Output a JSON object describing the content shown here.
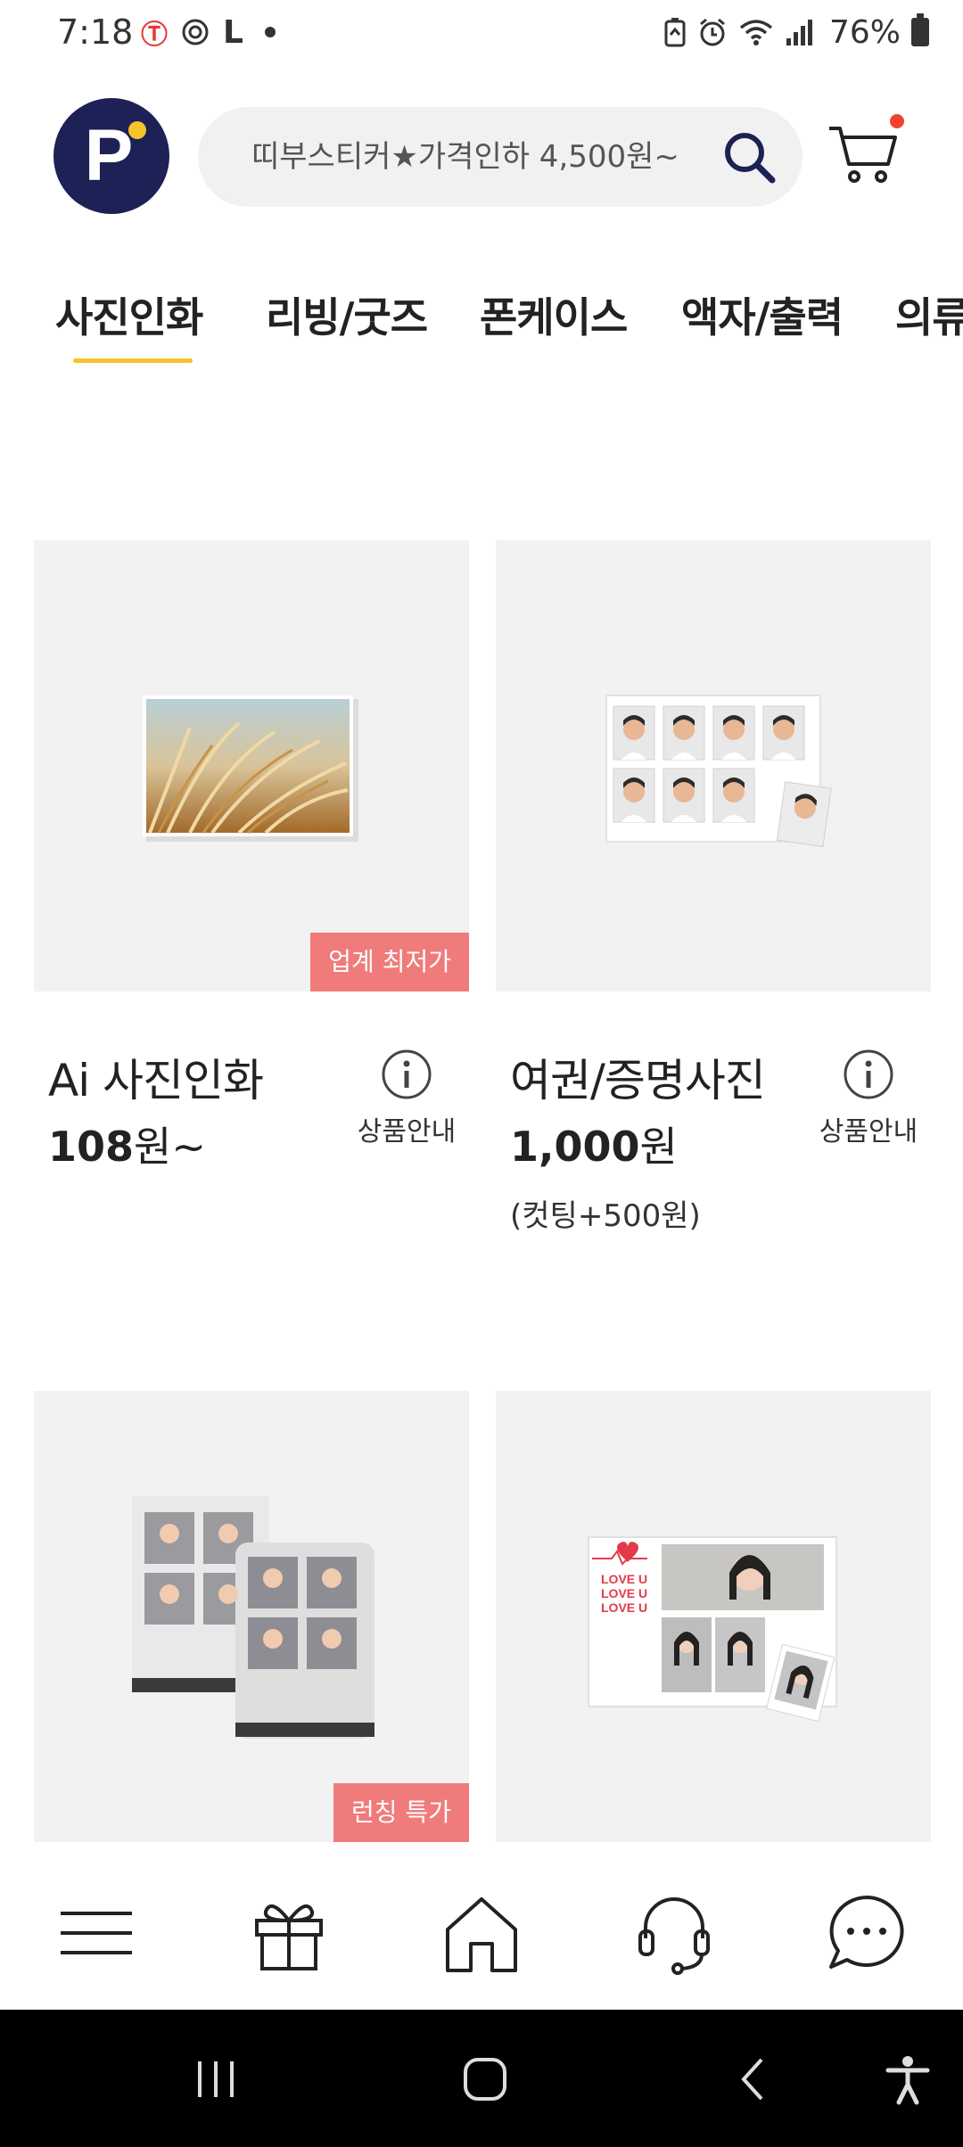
{
  "status_bar": {
    "time": "7:18",
    "left_icons": [
      "t-icon",
      "target-icon",
      "l-icon",
      "dot-icon"
    ],
    "right_icons": [
      "battery-saver-icon",
      "alarm-icon",
      "wifi-icon",
      "signal-icon"
    ],
    "battery_text": "76%"
  },
  "header": {
    "logo_letter": "P",
    "search_text": "띠부스티커★가격인하 4,500원~",
    "colors": {
      "logo_bg": "#1d2155",
      "logo_dot": "#f6c32b",
      "cart_dot": "#f0432e"
    }
  },
  "tabs": [
    {
      "label": "사진인화",
      "active": true
    },
    {
      "label": "리빙/굿즈",
      "active": false
    },
    {
      "label": "폰케이스",
      "active": false
    },
    {
      "label": "액자/출력",
      "active": false
    },
    {
      "label": "의류",
      "active": false
    }
  ],
  "products": [
    {
      "title": "Ai 사진인화",
      "price": "108",
      "price_unit": "원~",
      "note": "",
      "badge": "업계 최저가",
      "info_label": "상품안내",
      "image_icon": "grass-photo-icon"
    },
    {
      "title": "여권/증명사진",
      "price": "1,000",
      "price_unit": "원",
      "note": "(컷팅+500원)",
      "badge": "",
      "info_label": "상품안내",
      "image_icon": "id-photo-sheet-icon"
    },
    {
      "title": "",
      "price": "",
      "price_unit": "",
      "note": "",
      "badge": "런칭 특가",
      "info_label": "",
      "image_icon": "photo-booth-strip-icon"
    },
    {
      "title": "",
      "price": "",
      "price_unit": "",
      "note": "",
      "badge": "",
      "info_label": "",
      "image_icon": "love-u-photo-card-icon"
    }
  ],
  "bottom_nav": [
    {
      "name": "menu-icon"
    },
    {
      "name": "gift-icon"
    },
    {
      "name": "home-icon"
    },
    {
      "name": "headset-icon"
    },
    {
      "name": "chat-icon"
    }
  ],
  "system_nav": [
    "recents-icon",
    "home-circle-icon",
    "back-icon",
    "accessibility-icon"
  ]
}
